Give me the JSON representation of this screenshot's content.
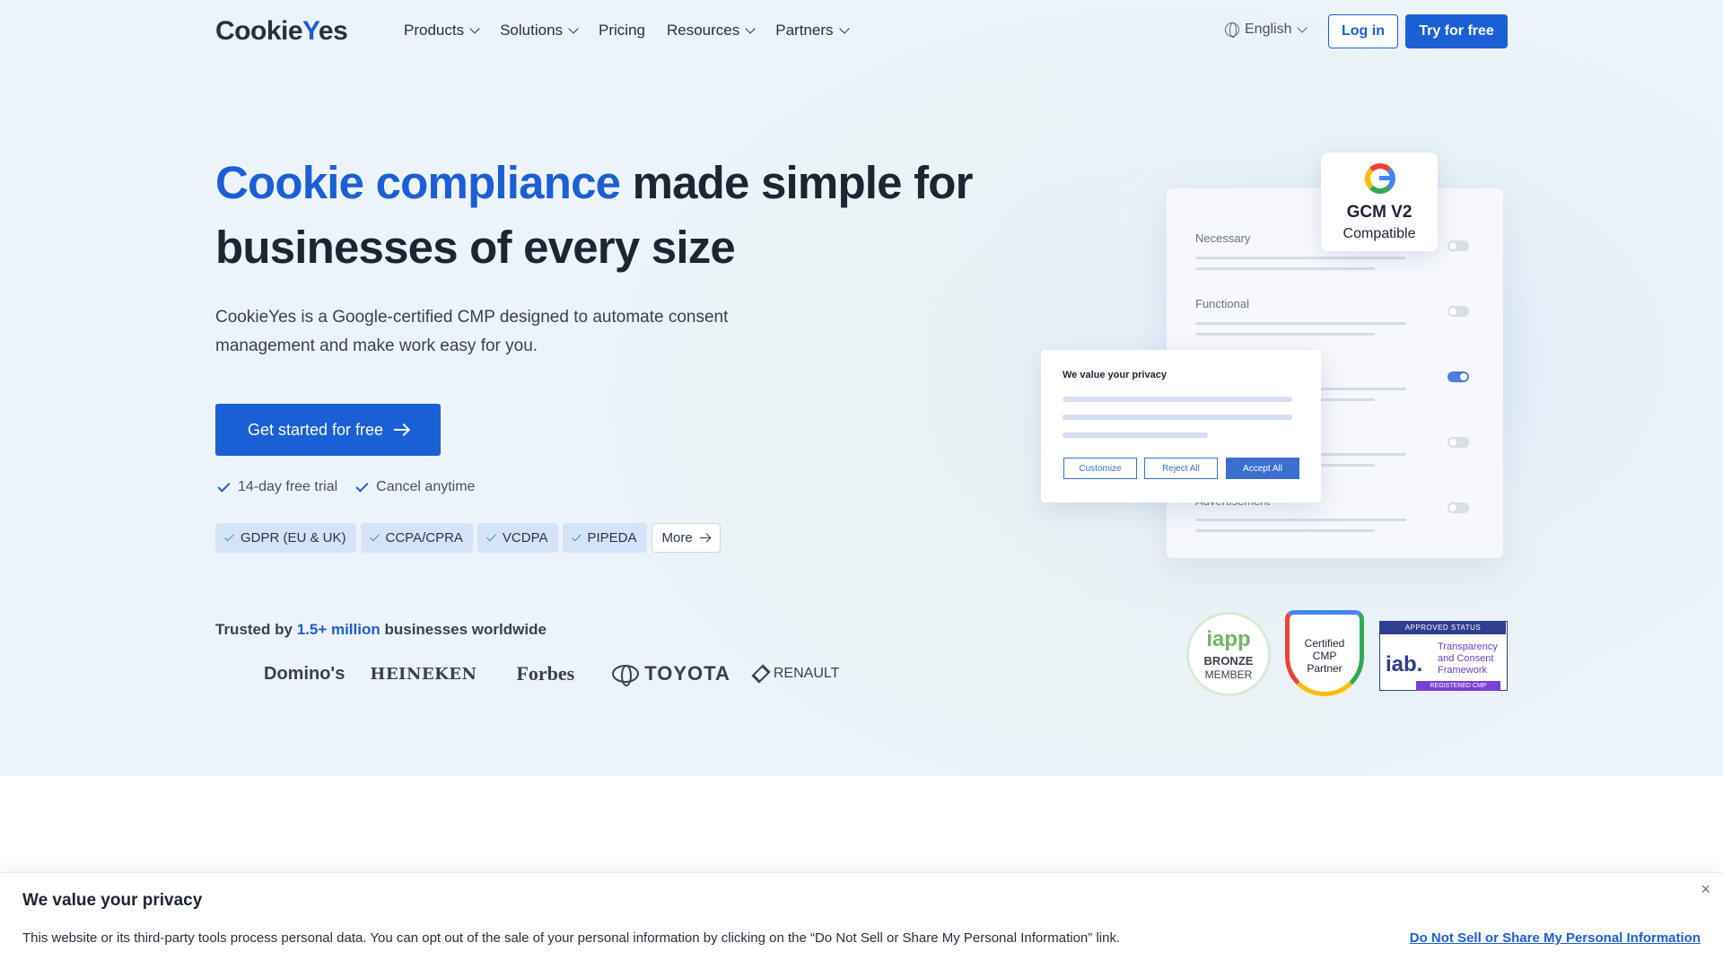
{
  "nav": {
    "logo_prefix": "Cookie",
    "logo_accent": "Y",
    "logo_suffix": "es",
    "menu": [
      {
        "label": "Products",
        "has_dropdown": true
      },
      {
        "label": "Solutions",
        "has_dropdown": true
      },
      {
        "label": "Pricing",
        "has_dropdown": false
      },
      {
        "label": "Resources",
        "has_dropdown": true
      },
      {
        "label": "Partners",
        "has_dropdown": true
      }
    ],
    "language": "English",
    "login_label": "Log in",
    "try_label": "Try for free"
  },
  "hero": {
    "headline_blue": "Cookie compliance",
    "headline_rest": " made simple for businesses of every size",
    "subtext": "CookieYes is a Google-certified CMP designed to automate consent management and make work easy for you.",
    "cta_label": "Get started for free",
    "checks": [
      "14-day free trial",
      "Cancel anytime"
    ],
    "tags": [
      "GDPR (EU & UK)",
      "CCPA/CPRA",
      "VCDPA",
      "PIPEDA"
    ],
    "more_label": "More"
  },
  "trust": {
    "prefix": "Trusted by ",
    "highlight": "1.5+ million",
    "suffix": " businesses worldwide",
    "brands": [
      "Domino's",
      "HEINEKEN",
      "Forbes",
      "TOYOTA",
      "RENAULT"
    ]
  },
  "illustration": {
    "rows": [
      {
        "label": "Necessary",
        "on": false
      },
      {
        "label": "Functional",
        "on": false
      },
      {
        "label": "",
        "on": true
      },
      {
        "label": "",
        "on": false
      },
      {
        "label": "Advertisement",
        "on": false
      }
    ],
    "gcm_title": "GCM V2",
    "gcm_sub": "Compatible",
    "popup_title": "We value your privacy",
    "popup_buttons": [
      "Customize",
      "Reject All",
      "Accept All"
    ]
  },
  "badges": {
    "iapp_top": "iapp",
    "iapp_mid": "BRONZE",
    "iapp_bot": "MEMBER",
    "cmp_lines": [
      "Certified",
      "CMP",
      "Partner"
    ],
    "iab_top": "APPROVED STATUS",
    "iab_logo": "iab.",
    "iab_text": "Transparency and Consent Framework",
    "iab_bottom": "REGISTERED CMP"
  },
  "banner": {
    "title": "We value your privacy",
    "text": "This website or its third-party tools process personal data. You can opt out of the sale of your personal information by clicking on the “Do Not Sell or Share My Personal Information” link.",
    "link": "Do Not Sell or Share My Personal Information",
    "close": "×"
  },
  "colors": {
    "brand_blue": "#1a5fd6",
    "text_dark": "#1f2433",
    "hero_bg": "#edf3fa"
  }
}
